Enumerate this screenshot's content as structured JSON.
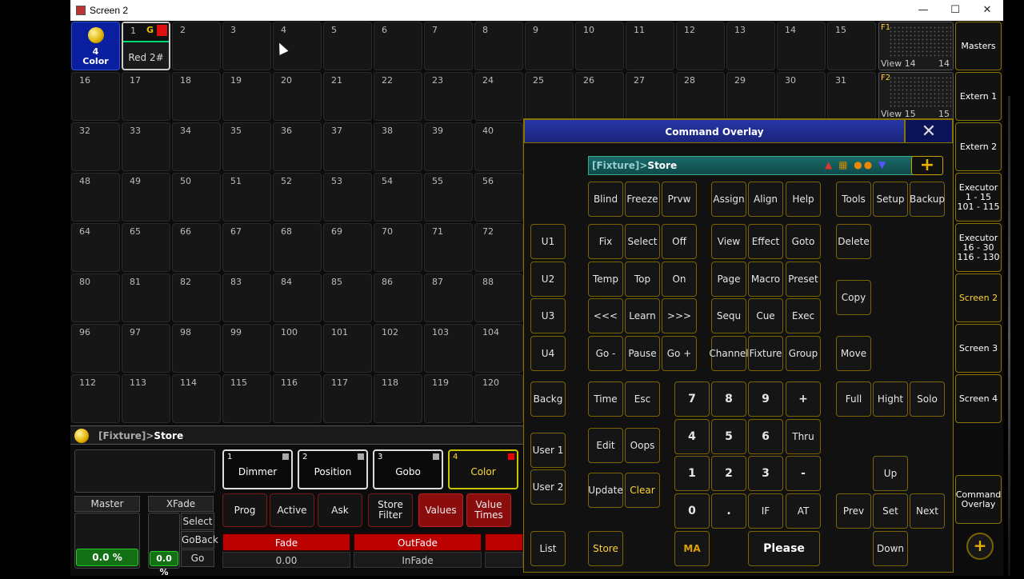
{
  "window": {
    "title": "Screen 2",
    "minimize": "—",
    "maximize": "☐",
    "close": "✕"
  },
  "grid": {
    "first_cell": {
      "number": "4",
      "label": "Color"
    },
    "selected_cell": {
      "number": "1",
      "flag": "G",
      "name": "Red 2#"
    },
    "numbers": [
      "2",
      "3",
      "4",
      "5",
      "6",
      "7",
      "8",
      "9",
      "10",
      "11",
      "12",
      "13",
      "14",
      "15",
      "16",
      "17",
      "18",
      "19",
      "20",
      "21",
      "22",
      "23",
      "24",
      "25",
      "26",
      "27",
      "28",
      "29",
      "30",
      "31",
      "32",
      "33",
      "34",
      "35",
      "36",
      "37",
      "38",
      "39",
      "40",
      "48",
      "49",
      "50",
      "51",
      "52",
      "53",
      "54",
      "55",
      "56",
      "64",
      "65",
      "66",
      "67",
      "68",
      "69",
      "70",
      "71",
      "72",
      "80",
      "81",
      "82",
      "83",
      "84",
      "85",
      "86",
      "87",
      "88",
      "96",
      "97",
      "98",
      "99",
      "100",
      "101",
      "102",
      "103",
      "104",
      "112",
      "113",
      "114",
      "115",
      "116",
      "117",
      "118",
      "119",
      "120"
    ]
  },
  "views": [
    {
      "label": "F1",
      "view": "View 14",
      "num": "14"
    },
    {
      "label": "F2",
      "view": "View 15",
      "num": "15"
    }
  ],
  "side_buttons": [
    "Masters",
    "Extern 1",
    "Extern 2",
    "Executor\n1 - 15\n101 - 115",
    "Executor\n16 - 30\n116 - 130",
    "Screen 2",
    "Screen 3",
    "Screen 4",
    "Command\nOverlay"
  ],
  "command_line": {
    "prefix": "[Fixture]>",
    "text": "Store"
  },
  "presets": [
    {
      "num": "1",
      "label": "Dimmer"
    },
    {
      "num": "2",
      "label": "Position"
    },
    {
      "num": "3",
      "label": "Gobo"
    },
    {
      "num": "4",
      "label": "Color"
    }
  ],
  "bottom_buttons": [
    "Prog",
    "Active",
    "Ask",
    "Store\nFilter",
    "Values",
    "Value\nTimes"
  ],
  "master": {
    "label": "Master",
    "value": "0.0 %"
  },
  "xfade": {
    "label": "XFade",
    "value": "0.0 %",
    "select": "Select",
    "goback": "GoBack",
    "go": "Go"
  },
  "fade": {
    "label": "Fade",
    "value": "0.00"
  },
  "outfade": {
    "label": "OutFade",
    "value": "InFade"
  },
  "overlay": {
    "title": "Command Overlay",
    "command_prefix": "[Fixture]>",
    "command_text": "Store",
    "keys": {
      "blind": "Blind",
      "freeze": "Freeze",
      "prvw": "Prvw",
      "assign": "Assign",
      "align": "Align",
      "help": "Help",
      "tools": "Tools",
      "setup": "Setup",
      "backup": "Backup",
      "u1": "U1",
      "fix": "Fix",
      "select": "Select",
      "off": "Off",
      "view": "View",
      "effect": "Effect",
      "goto": "Goto",
      "delete": "Delete",
      "u2": "U2",
      "temp": "Temp",
      "top": "Top",
      "on": "On",
      "page": "Page",
      "macro": "Macro",
      "preset": "Preset",
      "u3": "U3",
      "prev3": "<<<",
      "learn": "Learn",
      "next3": ">>>",
      "sequ": "Sequ",
      "cue": "Cue",
      "exec": "Exec",
      "copy": "Copy",
      "u4": "U4",
      "gominus": "Go -",
      "pause": "Pause",
      "goplus": "Go +",
      "channel": "Channel",
      "fixture": "Fixture",
      "group": "Group",
      "move": "Move",
      "backg": "Backg",
      "time": "Time",
      "esc": "Esc",
      "n7": "7",
      "n8": "8",
      "n9": "9",
      "plus": "+",
      "full": "Full",
      "hight": "Hight",
      "solo": "Solo",
      "user1": "User 1",
      "edit": "Edit",
      "oops": "Oops",
      "n4": "4",
      "n5": "5",
      "n6": "6",
      "thru": "Thru",
      "user2": "User 2",
      "update": "Update",
      "clear": "Clear",
      "n1": "1",
      "n2": "2",
      "n3": "3",
      "minus": "-",
      "up": "Up",
      "n0": "0",
      "dot": ".",
      "if": "IF",
      "at": "AT",
      "prev": "Prev",
      "set": "Set",
      "next": "Next",
      "list": "List",
      "store": "Store",
      "ma": "MA",
      "please": "Please",
      "down": "Down"
    }
  }
}
